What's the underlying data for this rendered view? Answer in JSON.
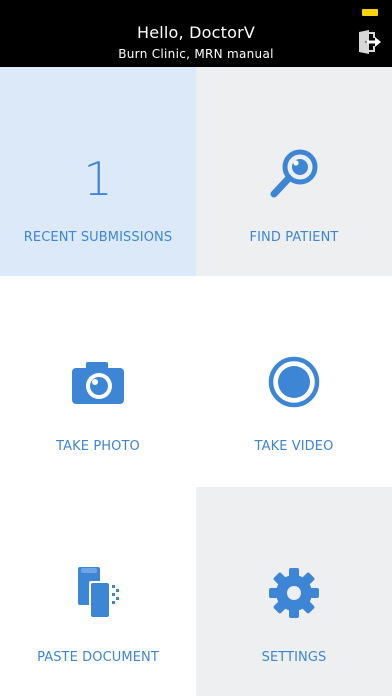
{
  "header": {
    "greeting": "Hello, DoctorV",
    "subtitle": "Burn Clinic, MRN manual",
    "logout_icon": "logout-icon",
    "battery_icon": "battery-icon"
  },
  "colors": {
    "accent": "#3d86d6",
    "header_bg": "#000000",
    "highlight_tile": "#dce9f8",
    "gray_tile": "#eeeff0",
    "white_tile": "#ffffff",
    "battery": "#f5d30f"
  },
  "tiles": [
    {
      "label": "RECENT SUBMISSIONS",
      "value": "1",
      "icon": "count-number"
    },
    {
      "label": "FIND PATIENT",
      "icon": "magnifier-icon"
    },
    {
      "label": "TAKE PHOTO",
      "icon": "camera-icon"
    },
    {
      "label": "TAKE VIDEO",
      "icon": "record-icon"
    },
    {
      "label": "PASTE DOCUMENT",
      "icon": "document-icon"
    },
    {
      "label": "SETTINGS",
      "icon": "gear-icon"
    }
  ]
}
